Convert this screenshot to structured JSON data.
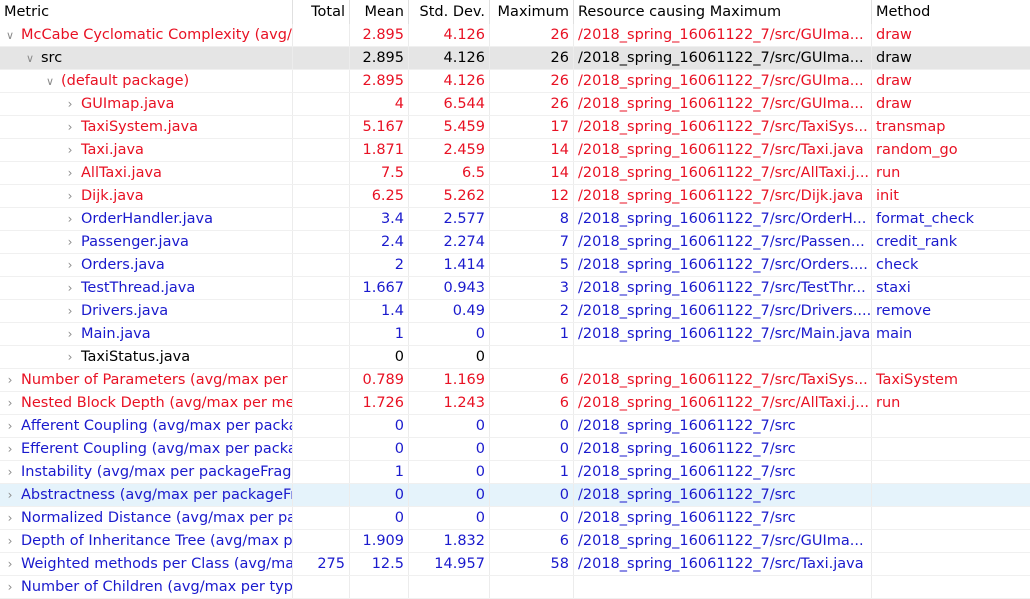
{
  "columns": [
    "Metric",
    "Total",
    "Mean",
    "Std. Dev.",
    "Maximum",
    "Resource causing Maximum",
    "Method"
  ],
  "rows": [
    {
      "metric": "McCabe Cyclomatic Complexity (avg/max per method)",
      "total": "",
      "mean": "2.895",
      "std": "4.126",
      "max": "26",
      "resource": "/2018_spring_16061122_7/src/GUIma...",
      "method": "draw",
      "color": "red",
      "indent": 0,
      "twisty": "expanded"
    },
    {
      "metric": "src",
      "total": "",
      "mean": "2.895",
      "std": "4.126",
      "max": "26",
      "resource": "/2018_spring_16061122_7/src/GUIma...",
      "method": "draw",
      "color": "black",
      "indent": 1,
      "twisty": "expanded",
      "selected": true
    },
    {
      "metric": "(default package)",
      "total": "",
      "mean": "2.895",
      "std": "4.126",
      "max": "26",
      "resource": "/2018_spring_16061122_7/src/GUIma...",
      "method": "draw",
      "color": "red",
      "indent": 2,
      "twisty": "expanded"
    },
    {
      "metric": "GUImap.java",
      "total": "",
      "mean": "4",
      "std": "6.544",
      "max": "26",
      "resource": "/2018_spring_16061122_7/src/GUIma...",
      "method": "draw",
      "color": "red",
      "indent": 3,
      "twisty": "collapsed"
    },
    {
      "metric": "TaxiSystem.java",
      "total": "",
      "mean": "5.167",
      "std": "5.459",
      "max": "17",
      "resource": "/2018_spring_16061122_7/src/TaxiSys...",
      "method": "transmap",
      "color": "red",
      "indent": 3,
      "twisty": "collapsed"
    },
    {
      "metric": "Taxi.java",
      "total": "",
      "mean": "1.871",
      "std": "2.459",
      "max": "14",
      "resource": "/2018_spring_16061122_7/src/Taxi.java",
      "method": "random_go",
      "color": "red",
      "indent": 3,
      "twisty": "collapsed"
    },
    {
      "metric": "AllTaxi.java",
      "total": "",
      "mean": "7.5",
      "std": "6.5",
      "max": "14",
      "resource": "/2018_spring_16061122_7/src/AllTaxi.j...",
      "method": "run",
      "color": "red",
      "indent": 3,
      "twisty": "collapsed"
    },
    {
      "metric": "Dijk.java",
      "total": "",
      "mean": "6.25",
      "std": "5.262",
      "max": "12",
      "resource": "/2018_spring_16061122_7/src/Dijk.java",
      "method": "init",
      "color": "red",
      "indent": 3,
      "twisty": "collapsed"
    },
    {
      "metric": "OrderHandler.java",
      "total": "",
      "mean": "3.4",
      "std": "2.577",
      "max": "8",
      "resource": "/2018_spring_16061122_7/src/OrderH...",
      "method": "format_check",
      "color": "blue",
      "indent": 3,
      "twisty": "collapsed"
    },
    {
      "metric": "Passenger.java",
      "total": "",
      "mean": "2.4",
      "std": "2.274",
      "max": "7",
      "resource": "/2018_spring_16061122_7/src/Passen...",
      "method": "credit_rank",
      "color": "blue",
      "indent": 3,
      "twisty": "collapsed"
    },
    {
      "metric": "Orders.java",
      "total": "",
      "mean": "2",
      "std": "1.414",
      "max": "5",
      "resource": "/2018_spring_16061122_7/src/Orders....",
      "method": "check",
      "color": "blue",
      "indent": 3,
      "twisty": "collapsed"
    },
    {
      "metric": "TestThread.java",
      "total": "",
      "mean": "1.667",
      "std": "0.943",
      "max": "3",
      "resource": "/2018_spring_16061122_7/src/TestThr...",
      "method": "staxi",
      "color": "blue",
      "indent": 3,
      "twisty": "collapsed"
    },
    {
      "metric": "Drivers.java",
      "total": "",
      "mean": "1.4",
      "std": "0.49",
      "max": "2",
      "resource": "/2018_spring_16061122_7/src/Drivers....",
      "method": "remove",
      "color": "blue",
      "indent": 3,
      "twisty": "collapsed"
    },
    {
      "metric": "Main.java",
      "total": "",
      "mean": "1",
      "std": "0",
      "max": "1",
      "resource": "/2018_spring_16061122_7/src/Main.java",
      "method": "main",
      "color": "blue",
      "indent": 3,
      "twisty": "collapsed"
    },
    {
      "metric": "TaxiStatus.java",
      "total": "",
      "mean": "0",
      "std": "0",
      "max": "",
      "resource": "",
      "method": "",
      "color": "black",
      "indent": 3,
      "twisty": "collapsed"
    },
    {
      "metric": "Number of Parameters (avg/max per method)",
      "total": "",
      "mean": "0.789",
      "std": "1.169",
      "max": "6",
      "resource": "/2018_spring_16061122_7/src/TaxiSys...",
      "method": "TaxiSystem",
      "color": "red",
      "indent": 0,
      "twisty": "collapsed"
    },
    {
      "metric": "Nested Block Depth (avg/max per method)",
      "total": "",
      "mean": "1.726",
      "std": "1.243",
      "max": "6",
      "resource": "/2018_spring_16061122_7/src/AllTaxi.j...",
      "method": "run",
      "color": "red",
      "indent": 0,
      "twisty": "collapsed"
    },
    {
      "metric": "Afferent Coupling (avg/max per packageFragment)",
      "total": "",
      "mean": "0",
      "std": "0",
      "max": "0",
      "resource": "/2018_spring_16061122_7/src",
      "method": "",
      "color": "blue",
      "indent": 0,
      "twisty": "collapsed"
    },
    {
      "metric": "Efferent Coupling (avg/max per packageFragment)",
      "total": "",
      "mean": "0",
      "std": "0",
      "max": "0",
      "resource": "/2018_spring_16061122_7/src",
      "method": "",
      "color": "blue",
      "indent": 0,
      "twisty": "collapsed"
    },
    {
      "metric": "Instability (avg/max per packageFragment)",
      "total": "",
      "mean": "1",
      "std": "0",
      "max": "1",
      "resource": "/2018_spring_16061122_7/src",
      "method": "",
      "color": "blue",
      "indent": 0,
      "twisty": "collapsed"
    },
    {
      "metric": "Abstractness (avg/max per packageFragment)",
      "total": "",
      "mean": "0",
      "std": "0",
      "max": "0",
      "resource": "/2018_spring_16061122_7/src",
      "method": "",
      "color": "blue",
      "indent": 0,
      "twisty": "collapsed",
      "hover": true
    },
    {
      "metric": "Normalized Distance (avg/max per packageFragment)",
      "total": "",
      "mean": "0",
      "std": "0",
      "max": "0",
      "resource": "/2018_spring_16061122_7/src",
      "method": "",
      "color": "blue",
      "indent": 0,
      "twisty": "collapsed"
    },
    {
      "metric": "Depth of Inheritance Tree (avg/max per type)",
      "total": "",
      "mean": "1.909",
      "std": "1.832",
      "max": "6",
      "resource": "/2018_spring_16061122_7/src/GUIma...",
      "method": "",
      "color": "blue",
      "indent": 0,
      "twisty": "collapsed"
    },
    {
      "metric": "Weighted methods per Class (avg/max per type)",
      "total": "275",
      "mean": "12.5",
      "std": "14.957",
      "max": "58",
      "resource": "/2018_spring_16061122_7/src/Taxi.java",
      "method": "",
      "color": "blue",
      "indent": 0,
      "twisty": "collapsed"
    },
    {
      "metric": "Number of Children (avg/max per type)",
      "total": "",
      "mean": "",
      "std": "",
      "max": "",
      "resource": "",
      "method": "",
      "color": "blue",
      "indent": 0,
      "twisty": "collapsed"
    }
  ]
}
